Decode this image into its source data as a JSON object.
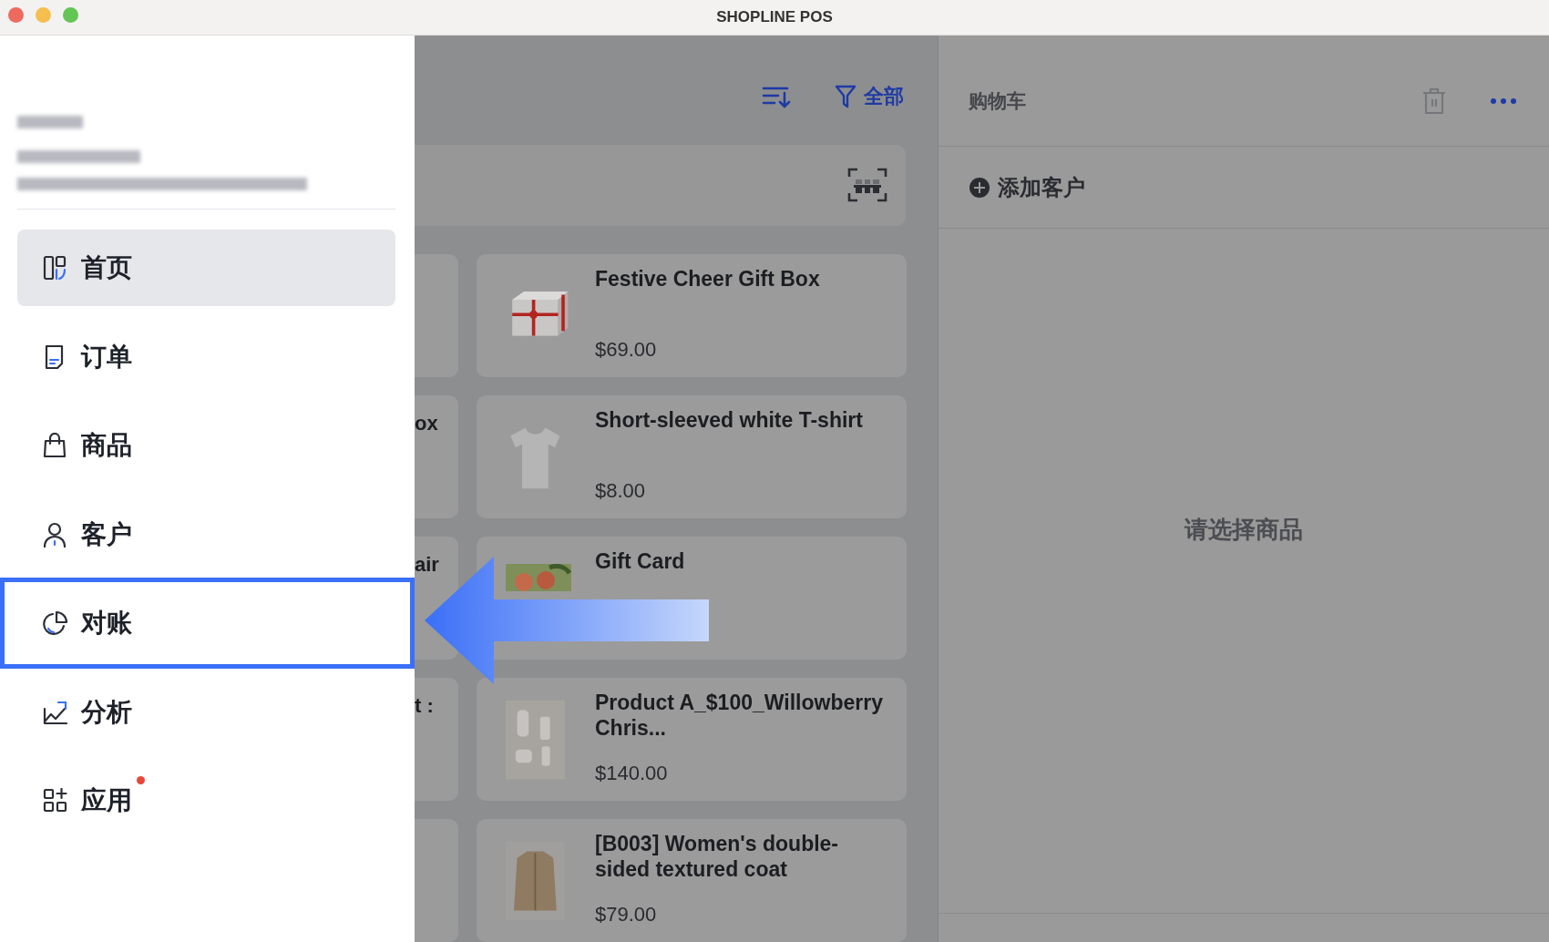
{
  "window": {
    "title": "SHOPLINE POS"
  },
  "sidebar": {
    "items": [
      {
        "label": "首页",
        "kind": "home",
        "selected": true,
        "highlighted": false,
        "badge_dot": false
      },
      {
        "label": "订单",
        "kind": "orders",
        "selected": false,
        "highlighted": false,
        "badge_dot": false
      },
      {
        "label": "商品",
        "kind": "products",
        "selected": false,
        "highlighted": false,
        "badge_dot": false
      },
      {
        "label": "客户",
        "kind": "customers",
        "selected": false,
        "highlighted": false,
        "badge_dot": false
      },
      {
        "label": "对账",
        "kind": "reconcile",
        "selected": false,
        "highlighted": true,
        "badge_dot": false
      },
      {
        "label": "分析",
        "kind": "analytics",
        "selected": false,
        "highlighted": false,
        "badge_dot": false
      },
      {
        "label": "应用",
        "kind": "apps",
        "selected": false,
        "highlighted": false,
        "badge_dot": true
      }
    ]
  },
  "toolbar": {
    "filter_label": "全部"
  },
  "products_left": [
    {
      "kind": "blank"
    },
    {
      "kind": "named",
      "name": "ox"
    },
    {
      "kind": "named",
      "name": "air"
    },
    {
      "kind": "named",
      "name": "t :"
    },
    {
      "kind": "blank"
    }
  ],
  "products": [
    {
      "name": "Festive Cheer Gift Box",
      "price": "$69.00",
      "kind": "giftbox"
    },
    {
      "name": "Short-sleeved white T-shirt",
      "price": "$8.00",
      "kind": "tshirt"
    },
    {
      "name": "Gift Card",
      "kind": "giftcard"
    },
    {
      "name": "Product A_$100_Willowberry Chris...",
      "price": "$140.00",
      "kind": "cosmetics"
    },
    {
      "name": "[B003] Women's double-sided textured coat",
      "price": "$79.00",
      "kind": "coat"
    }
  ],
  "cart": {
    "title": "购物车",
    "add_customer": "添加客户",
    "empty_message": "请选择商品"
  }
}
